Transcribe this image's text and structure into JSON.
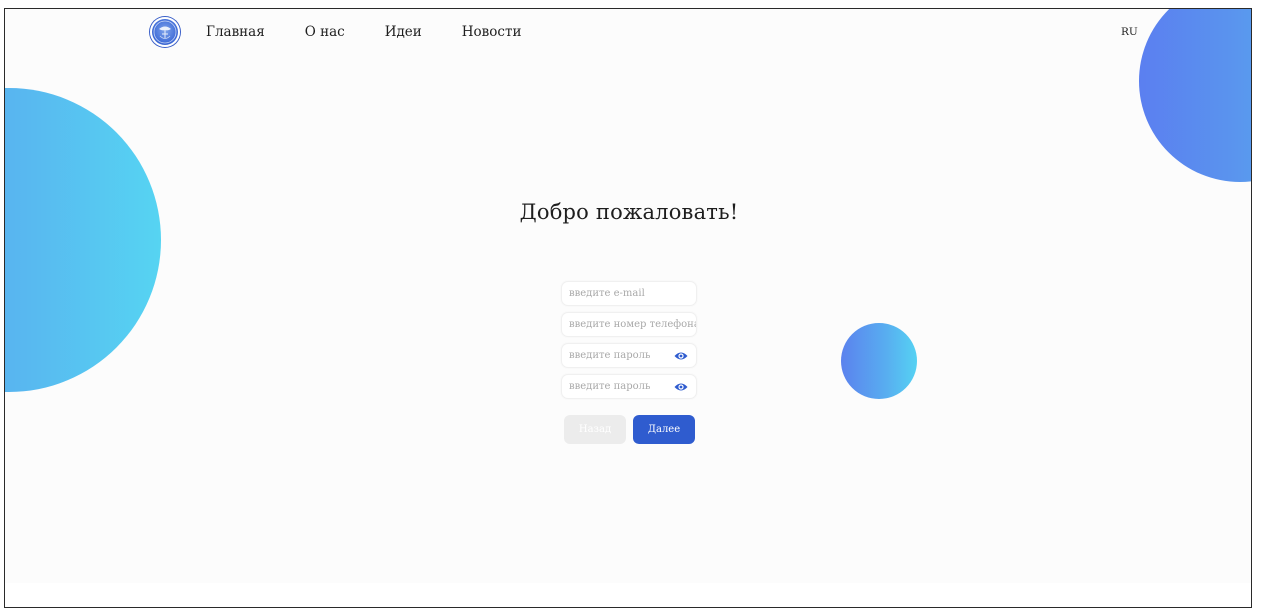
{
  "nav": {
    "logo_alt": "logo",
    "links": [
      {
        "label": "Главная"
      },
      {
        "label": "О нас"
      },
      {
        "label": "Идеи"
      },
      {
        "label": "Новости"
      }
    ],
    "language": "RU"
  },
  "main": {
    "title": "Добро пожаловать!"
  },
  "form": {
    "email_placeholder": "введите e-mail",
    "phone_placeholder": "введите номер телефона",
    "password_placeholder": "введите пароль",
    "password_confirm_placeholder": "введите пароль",
    "back_label": "Назад",
    "next_label": "Далее"
  },
  "colors": {
    "accent": "#2f5ccf",
    "eye_icon": "#2f5ccf",
    "back_button": "#ececec"
  }
}
